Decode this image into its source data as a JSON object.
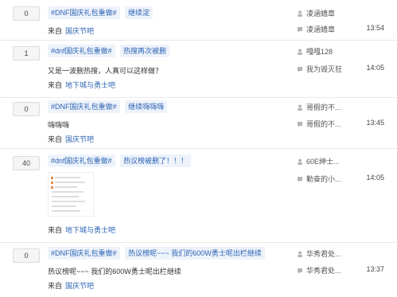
{
  "posts": [
    {
      "count": "0",
      "tags": [
        "#DNF国庆礼包重做#"
      ],
      "title": "继续淀",
      "snippet": "",
      "from_label": "来自",
      "forum": "国庆节吧",
      "author": "凌涵嫱章",
      "replier": "凌涵嫱章",
      "time": "13:54"
    },
    {
      "count": "1",
      "tags": [
        "#dnf国庆礼包重做#"
      ],
      "title": "热搜再次被删",
      "snippet": "又是一波删热搜，人真可以这样做？",
      "from_label": "来自",
      "forum": "地下城与勇士吧",
      "author": "嘎嘎128",
      "replier": "我为毁灭狂",
      "time": "14:05"
    },
    {
      "count": "0",
      "tags": [
        "#DNF国庆礼包重做#"
      ],
      "title": "继续嗨嗨嗨",
      "snippet": "嗨嗨嗨",
      "from_label": "来自",
      "forum": "国庆节吧",
      "author": "哥假的不...",
      "replier": "哥假的不...",
      "time": "13:45"
    },
    {
      "count": "40",
      "tags": [
        "#dnf国庆礼包重做#"
      ],
      "title": "热议榜被删了！！！",
      "snippet": "",
      "from_label": "来自",
      "forum": "地下城与勇士吧",
      "author": "60E绅士...",
      "replier": "勤奋的小...",
      "time": "14:05"
    },
    {
      "count": "0",
      "tags": [
        "#DNF国庆礼包重做#"
      ],
      "title": "热议榜呢~~~ 我们的600W勇士呢出栏继续",
      "snippet": "热议榜呢~~~ 我们的600W勇士呢出栏继续",
      "from_label": "来自",
      "forum": "国庆节吧",
      "author": "华秀君处...",
      "replier": "华秀君处...",
      "time": "13:37"
    }
  ],
  "icons": {
    "author": "person-icon",
    "replier": "reply-icon"
  },
  "colors": {
    "tag_bg": "#eef3fb",
    "link": "#2d64b3",
    "divider": "#e8e8e8"
  }
}
